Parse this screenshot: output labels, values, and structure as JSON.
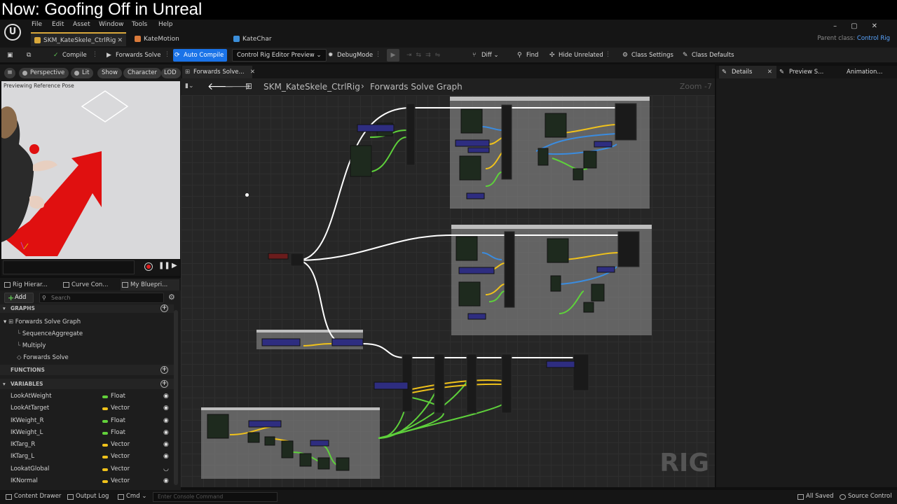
{
  "banner": {
    "title": "Now: Goofing Off in Unreal"
  },
  "menubar": {
    "items": [
      "File",
      "Edit",
      "Asset",
      "Window",
      "Tools",
      "Help"
    ]
  },
  "document_tabs": [
    {
      "label": "SKM_KateSkele_CtrlRig",
      "color": "#d9a83b"
    },
    {
      "label": "KateMotion",
      "color": "#d97a3b"
    },
    {
      "label": "KateChar",
      "color": "#3b8ed9"
    }
  ],
  "parent_class": {
    "label": "Parent class:",
    "value": "Control Rig"
  },
  "toolbar": {
    "compile": "Compile",
    "forwards_solve": "Forwards Solve",
    "auto_compile": "Auto Compile",
    "preview_dropdown": "Control Rig Editor Preview",
    "debug_mode": "DebugMode",
    "diff": "Diff",
    "find": "Find",
    "hide_unrelated": "Hide Unrelated",
    "class_settings": "Class Settings",
    "class_defaults": "Class Defaults"
  },
  "viewport": {
    "chips": [
      "Perspective",
      "Lit",
      "Show",
      "Character",
      "LOD"
    ],
    "caption": "Previewing Reference Pose"
  },
  "left_tabs": [
    "Rig Hierar...",
    "Curve Con...",
    "My Bluepri..."
  ],
  "my_blueprint": {
    "add_label": "Add",
    "search_placeholder": "Search",
    "graphs_header": "GRAPHS",
    "graph_root": "Forwards Solve Graph",
    "graph_children": [
      "SequenceAggregate",
      "Multiply",
      "Forwards Solve"
    ],
    "functions_header": "FUNCTIONS",
    "variables_header": "VARIABLES",
    "variables": [
      {
        "name": "LookAtWeight",
        "type": "Float",
        "color": "#62d13b"
      },
      {
        "name": "LookAtTarget",
        "type": "Vector",
        "color": "#f0c21b"
      },
      {
        "name": "IKWeight_R",
        "type": "Float",
        "color": "#62d13b"
      },
      {
        "name": "IKWeight_L",
        "type": "Float",
        "color": "#62d13b"
      },
      {
        "name": "IKTarg_R",
        "type": "Vector",
        "color": "#f0c21b"
      },
      {
        "name": "IKTarg_L",
        "type": "Vector",
        "color": "#f0c21b"
      },
      {
        "name": "LookatGlobal",
        "type": "Vector",
        "color": "#f0c21b"
      },
      {
        "name": "IKNormal",
        "type": "Vector",
        "color": "#f0c21b"
      }
    ]
  },
  "graph": {
    "tab_label": "Forwards Solve...",
    "breadcrumb_root": "SKM_KateSkele_CtrlRig",
    "breadcrumb_leaf": "Forwards Solve Graph",
    "zoom": "Zoom -7",
    "watermark": "RIG"
  },
  "details_tabs": [
    "Details",
    "Preview S...",
    "Animation..."
  ],
  "statusbar": {
    "content_drawer": "Content Drawer",
    "output_log": "Output Log",
    "cmd": "Cmd",
    "console_placeholder": "Enter Console Command",
    "all_saved": "All Saved",
    "source_control": "Source Control"
  }
}
